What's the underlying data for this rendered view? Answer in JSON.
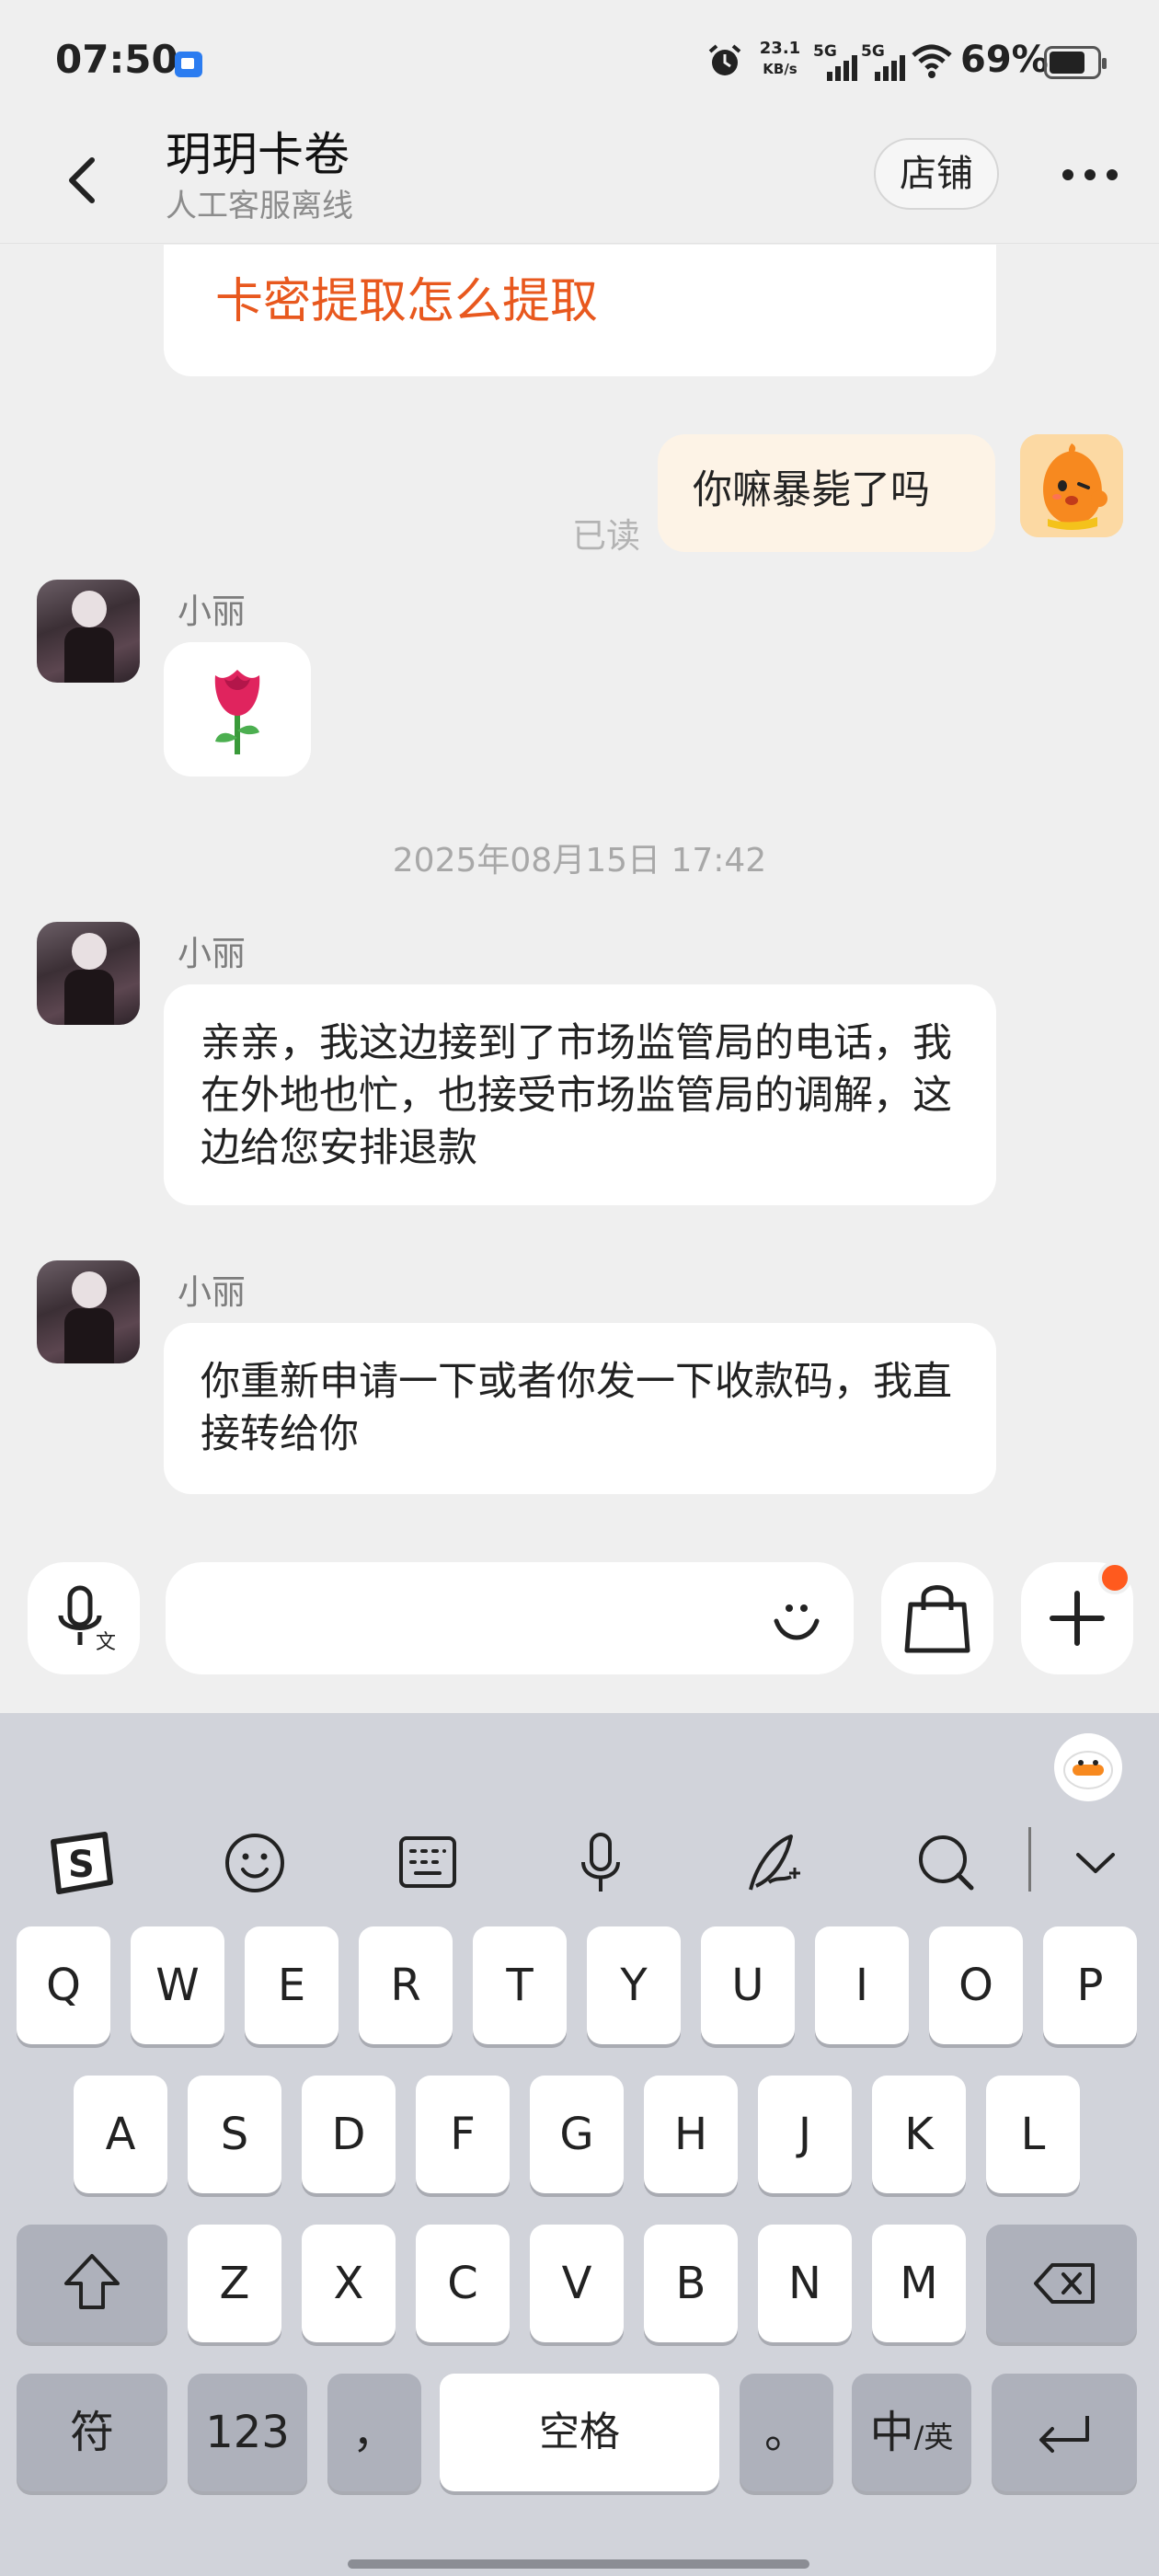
{
  "status_bar": {
    "time": "07:50",
    "network_speed_value": "23.1",
    "network_speed_unit": "KB/s",
    "signal_1": "5G",
    "signal_2": "5G",
    "battery_percent": "69%"
  },
  "header": {
    "title": "玥玥卡卷",
    "subtitle": "人工客服离线",
    "store_button": "店铺"
  },
  "messages": {
    "card_link": "卡密提取怎么提取",
    "mine_1": "你嘛暴毙了吗",
    "read_status": "已读",
    "peer_name": "小丽",
    "rose_emoji": "🌹",
    "timestamp": "2025年08月15日 17:42",
    "peer_msg_1": "亲亲，我这边接到了市场监管局的电话，我在外地也忙，也接受市场监管局的调解，这边给您安排退款",
    "peer_msg_2": "你重新申请一下或者你发一下收款码，我直接转给你"
  },
  "input_bar": {
    "icons": [
      "voice-to-text-icon",
      "emoji-icon",
      "shopping-bag-icon",
      "plus-icon"
    ],
    "has_notification_dot": true
  },
  "keyboard": {
    "toolbar_icons": [
      "sogou-logo-icon",
      "emoji-icon",
      "keyboard-icon",
      "microphone-icon",
      "handwriting-icon",
      "search-icon",
      "collapse-icon"
    ],
    "row1": [
      "Q",
      "W",
      "E",
      "R",
      "T",
      "Y",
      "U",
      "I",
      "O",
      "P"
    ],
    "row2": [
      "A",
      "S",
      "D",
      "F",
      "G",
      "H",
      "J",
      "K",
      "L"
    ],
    "row3": [
      "Z",
      "X",
      "C",
      "V",
      "B",
      "N",
      "M"
    ],
    "symbols_key": "符",
    "numbers_key": "123",
    "comma_key": "，",
    "space_key": "空格",
    "period_key": "。",
    "lang_key_main": "中",
    "lang_key_sub": "/英"
  }
}
